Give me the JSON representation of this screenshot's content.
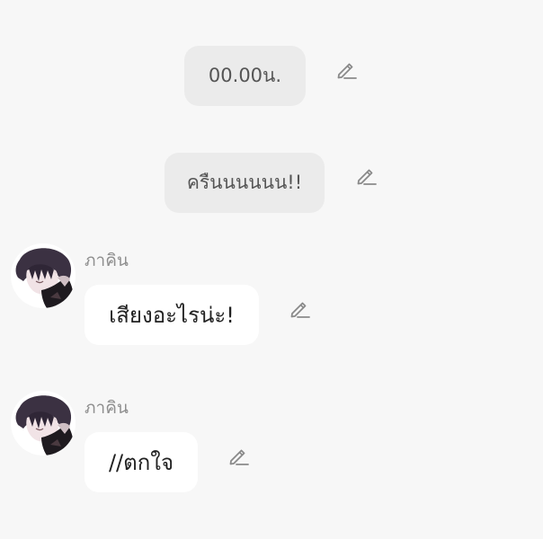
{
  "chat": {
    "narration_1": "00.00น.",
    "narration_2": "ครืนนนนนน!!",
    "speaker_1": "ภาคิน",
    "message_1": "เสียงอะไรน่ะ!",
    "speaker_2": "ภาคิน",
    "message_2": "//ตกใจ"
  },
  "icons": {
    "edit": "pencil-edit-icon",
    "avatar": "character-avatar"
  },
  "colors": {
    "background": "#f7f7f7",
    "narration_bg": "#ebebeb",
    "bubble_bg": "#ffffff",
    "speaker_text": "#8e8e8e",
    "icon_stroke": "#8a8a8a"
  }
}
